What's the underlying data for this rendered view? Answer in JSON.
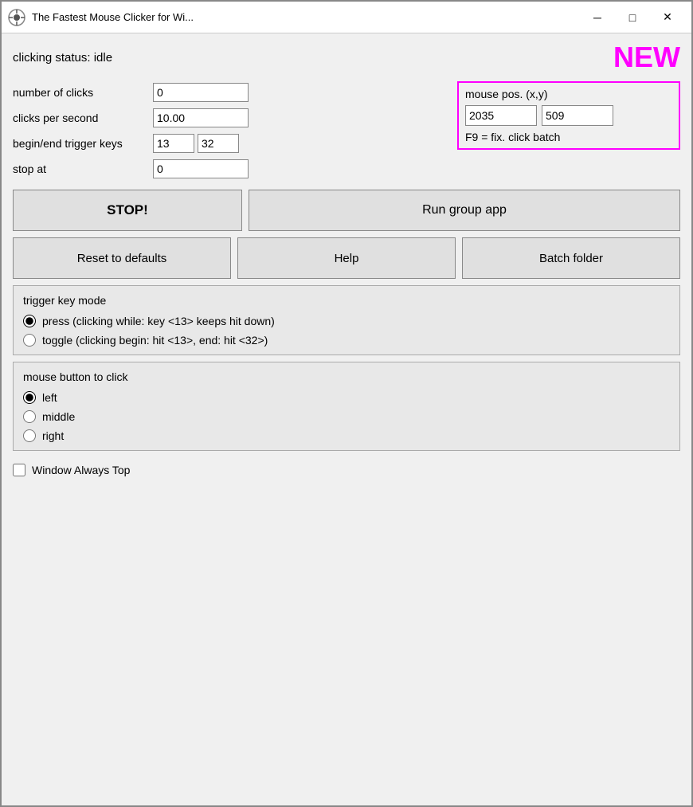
{
  "titleBar": {
    "title": "The Fastest Mouse Clicker for Wi...",
    "minimizeLabel": "─",
    "maximizeLabel": "□",
    "closeLabel": "✕"
  },
  "status": {
    "label": "clicking status: idle",
    "newBadge": "NEW"
  },
  "fields": {
    "numberOfClicks": {
      "label": "number of clicks",
      "value": "0"
    },
    "clicksPerSecond": {
      "label": "clicks per second",
      "value": "10.00"
    },
    "triggerKeys": {
      "label": "begin/end trigger keys",
      "value1": "13",
      "value2": "32"
    },
    "stopAt": {
      "label": "stop at",
      "value": "0"
    }
  },
  "mousePos": {
    "label": "mouse pos. (x,y)",
    "x": "2035",
    "y": "509",
    "f9text": "F9 = fix. click batch"
  },
  "buttons": {
    "stop": "STOP!",
    "runGroup": "Run group app",
    "resetDefaults": "Reset to defaults",
    "help": "Help",
    "batchFolder": "Batch folder"
  },
  "triggerKeyMode": {
    "sectionTitle": "trigger key mode",
    "pressLabel": "press (clicking while: key <13> keeps hit down)",
    "toggleLabel": "toggle (clicking begin: hit <13>, end: hit <32>)"
  },
  "mouseButtonToClick": {
    "sectionTitle": "mouse button to click",
    "leftLabel": "left",
    "middleLabel": "middle",
    "rightLabel": "right"
  },
  "windowAlwaysTop": {
    "label": "Window Always Top"
  }
}
